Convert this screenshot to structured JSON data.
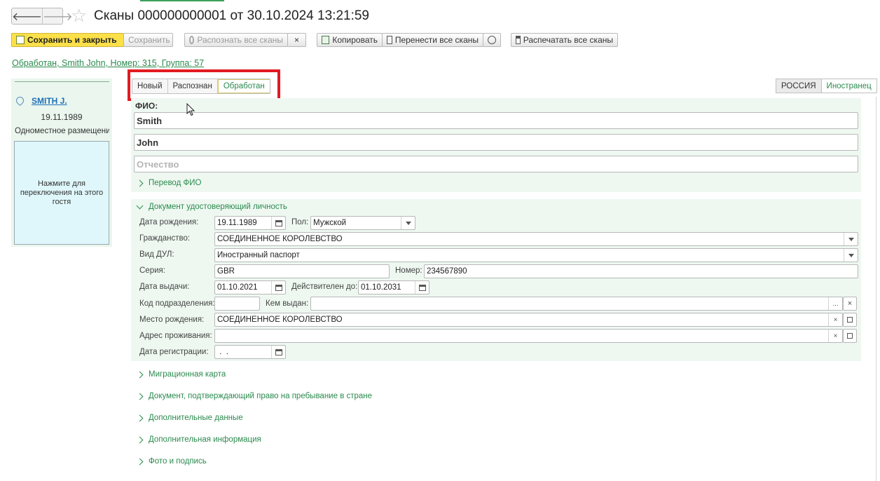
{
  "window": {
    "title": "Сканы 000000000001 от 30.10.2024 13:21:59",
    "back_glyph": "🡐",
    "forward_glyph": "🡒",
    "star_glyph": "☆"
  },
  "toolbar": {
    "save_close": "Сохранить и закрыть",
    "save": "Сохранить",
    "recognize_all": "Распознать все сканы",
    "close_x": "×",
    "copy": "Копировать",
    "move_all": "Перенести все сканы",
    "print_all": "Распечатать все сканы"
  },
  "status_link": "Обработан, Smith John, Номер: 315, Группа: 57",
  "guest_panel": {
    "name": "SMITH J.",
    "birth_date": "19.11.1989",
    "room": "Одноместное размещение",
    "switch_hint": "Нажмите для переключения на этого гостя"
  },
  "status_tabs": [
    {
      "label": "Новый",
      "active": false
    },
    {
      "label": "Распознан",
      "active": false
    },
    {
      "label": "Обработан",
      "active": true
    }
  ],
  "country_tabs": [
    {
      "label": "РОССИЯ",
      "selected": true
    },
    {
      "label": "Иностранец",
      "selected": false
    }
  ],
  "fio": {
    "label": "ФИО:",
    "last_name": "Smith",
    "first_name": "John",
    "middle_name_placeholder": "Отчество",
    "translation_label": "Перевод ФИО"
  },
  "identity_doc": {
    "section_label": "Документ удостоверяющий личность",
    "birth_date_label": "Дата рождения:",
    "birth_date": "19.11.1989",
    "gender_label": "Пол:",
    "gender": "Мужской",
    "citizenship_label": "Гражданство:",
    "citizenship": "СОЕДИНЕННОЕ КОРОЛЕВСТВО",
    "doc_type_label": "Вид ДУЛ:",
    "doc_type": "Иностранный паспорт",
    "series_label": "Серия:",
    "series": "GBR",
    "number_label": "Номер:",
    "number": "234567890",
    "issue_date_label": "Дата выдачи:",
    "issue_date": "01.10.2021",
    "valid_until_label": "Действителен до:",
    "valid_until": "01.10.2031",
    "division_code_label": "Код подразделения:",
    "division_code": "",
    "issued_by_label": "Кем выдан:",
    "issued_by": "",
    "birth_place_label": "Место рождения:",
    "birth_place": "СОЕДИНЕННОЕ КОРОЛЕВСТВО",
    "address_label": "Адрес проживания:",
    "address": "",
    "registration_date_label": "Дата регистрации:",
    "registration_date": " .  ."
  },
  "sections": [
    "Миграционная карта",
    "Документ, подтверждающий право на пребывание в стране",
    "Дополнительные данные",
    "Дополнительная информация",
    "Фото и подпись"
  ],
  "colors": {
    "accent_green": "#2b8a4e",
    "highlight_red": "#e21a22",
    "primary_yellow": "#fbe049"
  }
}
